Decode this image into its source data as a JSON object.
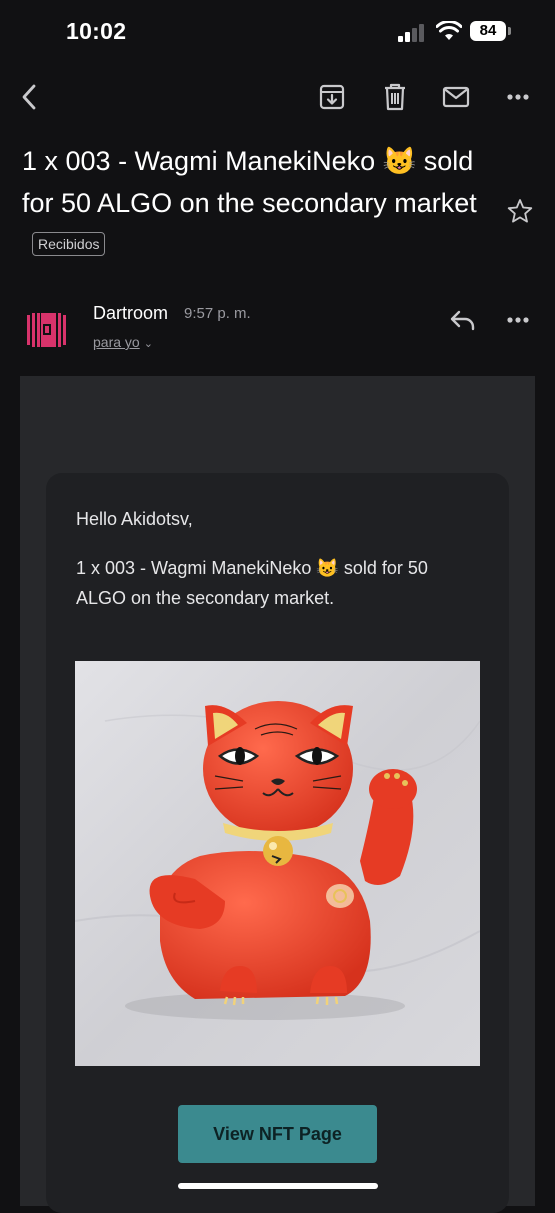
{
  "status_bar": {
    "time": "10:02",
    "battery": "84"
  },
  "action_bar": {
    "back": "back-arrow-icon",
    "archive": "archive-icon",
    "delete": "trash-icon",
    "mark_unread": "mail-icon",
    "more": "more-horizontal-icon"
  },
  "email": {
    "subject": "1 x 003 - Wagmi ManekiNeko 😺 sold for 50 ALGO on the secondary market",
    "label": "Recibidos",
    "sender": {
      "name": "Dartroom",
      "time": "9:57 p. m.",
      "recipient": "para yo"
    },
    "body": {
      "greeting": "Hello Akidotsv,",
      "message": "1 x 003 - Wagmi ManekiNeko 😺 sold for 50 ALGO on the secondary market.",
      "button_label": "View NFT Page"
    }
  },
  "colors": {
    "background": "#111113",
    "card": "#1f2023",
    "button": "#3b8a8f",
    "avatar": "#d8336b",
    "cat": "#e0432e"
  }
}
